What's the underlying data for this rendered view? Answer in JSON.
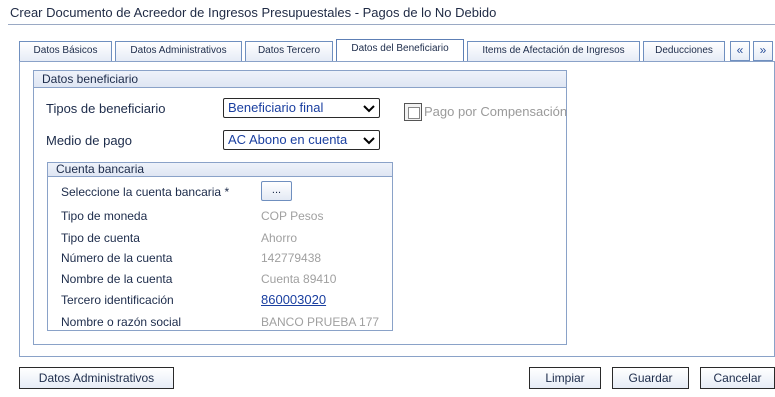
{
  "page": {
    "title": "Crear Documento de Acreedor de Ingresos Presupuestales - Pagos de lo No Debido"
  },
  "tabs": [
    {
      "label": "Datos Básicos"
    },
    {
      "label": "Datos Administrativos"
    },
    {
      "label": "Datos Tercero"
    },
    {
      "label": "Datos del Beneficiario",
      "active": true
    },
    {
      "label": "Items de Afectación de Ingresos"
    },
    {
      "label": "Deducciones"
    }
  ],
  "tab_nav": {
    "prev": "«",
    "next": "»"
  },
  "beneficiario": {
    "legend": "Datos beneficiario",
    "tipos_label": "Tipos de beneficiario",
    "tipos_value": "Beneficiario final",
    "medio_label": "Medio de pago",
    "medio_value": "AC Abono en cuenta",
    "compensacion_label": "Pago por Compensación"
  },
  "cuenta": {
    "legend": "Cuenta bancaria",
    "seleccione_label": "Seleccione la cuenta bancaria *",
    "seleccione_button": "...",
    "rows": [
      {
        "label": "Tipo de moneda",
        "value": "COP Pesos"
      },
      {
        "label": "Tipo de cuenta",
        "value": "Ahorro"
      },
      {
        "label": "Número de la cuenta",
        "value": "142779438"
      },
      {
        "label": "Nombre de la cuenta",
        "value": "Cuenta 89410"
      },
      {
        "label": "Tercero identificación",
        "value": "860003020"
      },
      {
        "label": "Nombre o razón social",
        "value": "BANCO PRUEBA 177"
      }
    ]
  },
  "footer": {
    "datos_admin": "Datos Administrativos",
    "limpiar": "Limpiar",
    "guardar": "Guardar",
    "cancelar": "Cancelar"
  }
}
